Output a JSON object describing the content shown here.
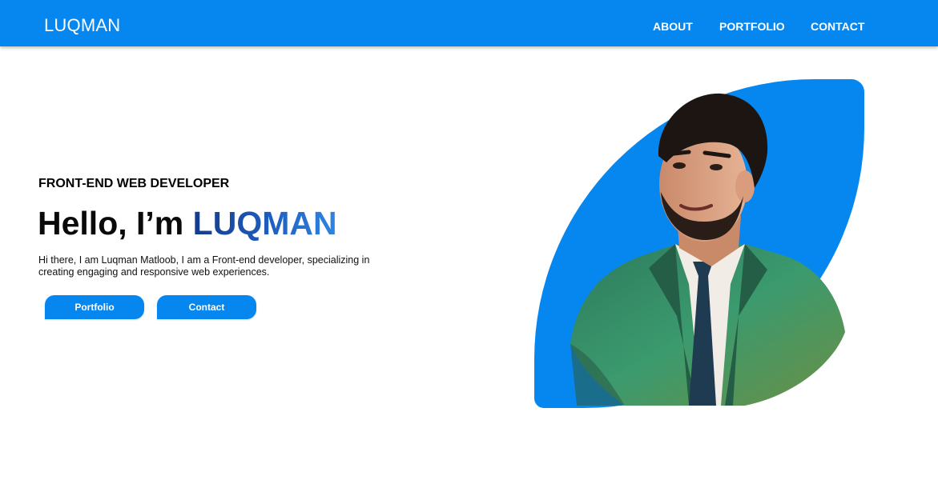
{
  "nav": {
    "logo": "LUQMAN",
    "links": [
      "ABOUT",
      "PORTFOLIO",
      "CONTACT"
    ]
  },
  "hero": {
    "subtitle": "FRONT-END WEB DEVELOPER",
    "greeting": "Hello, I’m",
    "name": "LUQMAN",
    "description": "Hi there, I am Luqman Matloob, I am a Front-end developer, specializing in creating engaging and responsive web experiences.",
    "buttons": {
      "portfolio": "Portfolio",
      "contact": "Contact"
    }
  },
  "colors": {
    "primary": "#0687f0",
    "name_gradient_start": "#153a8c",
    "name_gradient_end": "#2f86e0",
    "text": "#000000",
    "background": "#ffffff"
  },
  "icons": {
    "portrait": "developer-portrait-illustration"
  }
}
